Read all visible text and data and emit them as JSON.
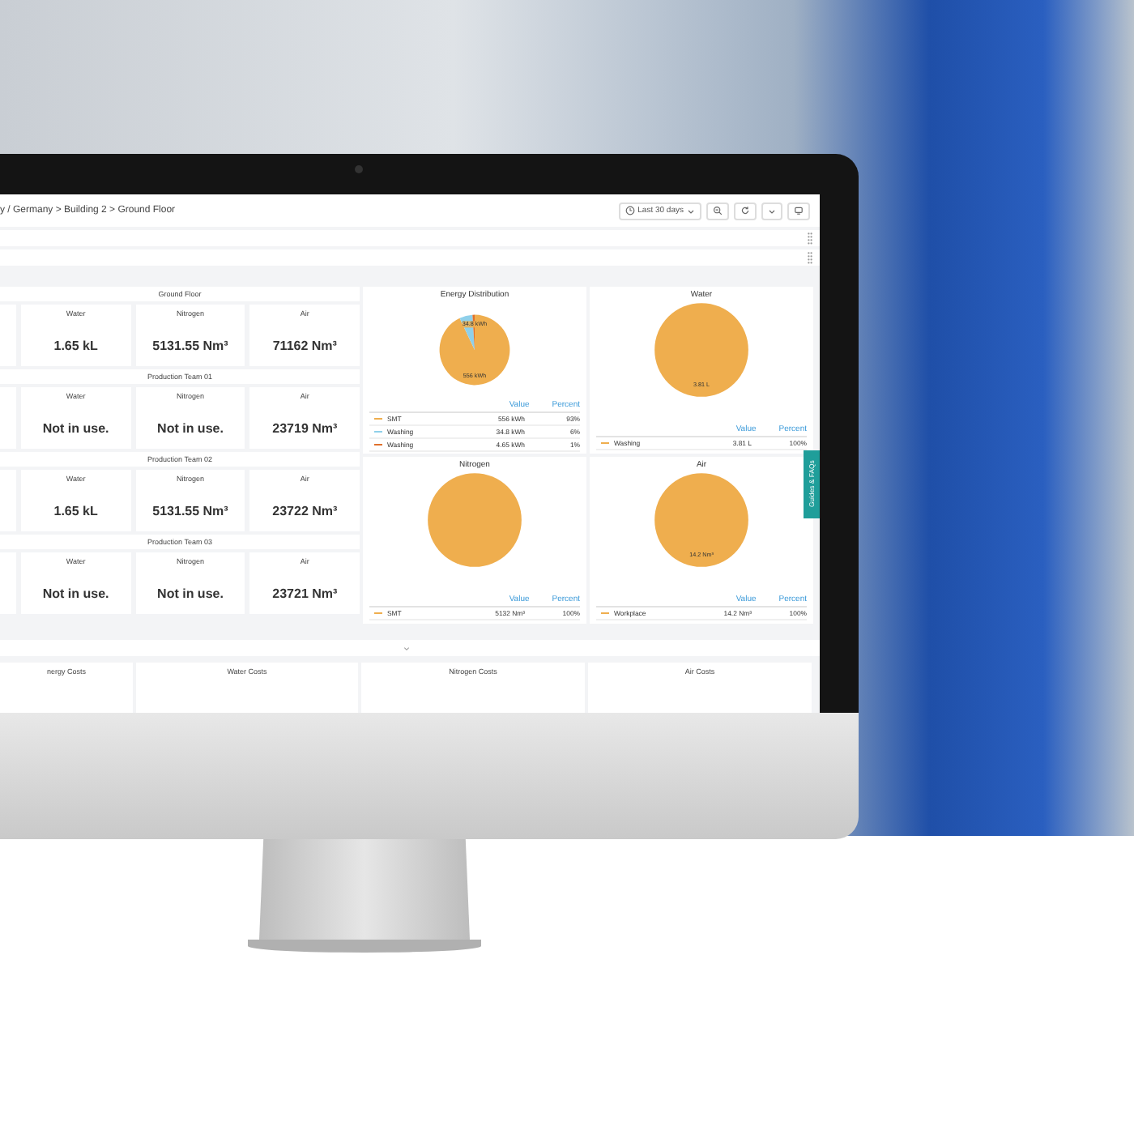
{
  "breadcrumb": "y / Germany > Building 2 > Ground Floor",
  "time_picker": "Last 30 days",
  "sections": [
    {
      "title": "Ground Floor",
      "tiles": [
        {
          "label": "Water",
          "value": "1.65 kL"
        },
        {
          "label": "Nitrogen",
          "value": "5131.55 Nm³"
        },
        {
          "label": "Air",
          "value": "71162 Nm³"
        }
      ]
    },
    {
      "title": "Production Team 01",
      "tiles": [
        {
          "label": "Water",
          "value": "Not in use."
        },
        {
          "label": "Nitrogen",
          "value": "Not in use."
        },
        {
          "label": "Air",
          "value": "23719 Nm³"
        }
      ]
    },
    {
      "title": "Production Team 02",
      "tiles": [
        {
          "label": "Water",
          "value": "1.65 kL"
        },
        {
          "label": "Nitrogen",
          "value": "5131.55 Nm³"
        },
        {
          "label": "Air",
          "value": "23722 Nm³"
        }
      ]
    },
    {
      "title": "Production Team 03",
      "tiles": [
        {
          "label": "Water",
          "value": "Not in use."
        },
        {
          "label": "Nitrogen",
          "value": "Not in use."
        },
        {
          "label": "Air",
          "value": "23721 Nm³"
        }
      ]
    }
  ],
  "pie_panels": [
    {
      "title": "Energy Distribution",
      "slice_labels": [
        "34.8 kWh",
        "556 kWh"
      ],
      "legend": {
        "value_header": "Value",
        "percent_header": "Percent",
        "rows": [
          {
            "name": "SMT",
            "value": "556 kWh",
            "percent": "93%",
            "color": "#efae4e"
          },
          {
            "name": "Washing",
            "value": "34.8 kWh",
            "percent": "6%",
            "color": "#8fd0ea"
          },
          {
            "name": "Washing",
            "value": "4.65 kWh",
            "percent": "1%",
            "color": "#e0702c"
          }
        ]
      }
    },
    {
      "title": "Water",
      "slice_labels": [
        "3.81 L"
      ],
      "legend": {
        "value_header": "Value",
        "percent_header": "Percent",
        "rows": [
          {
            "name": "Washing",
            "value": "3.81 L",
            "percent": "100%",
            "color": "#efae4e"
          }
        ]
      }
    },
    {
      "title": "Nitrogen",
      "legend": {
        "value_header": "Value",
        "percent_header": "Percent",
        "rows": [
          {
            "name": "SMT",
            "value": "5132 Nm³",
            "percent": "100%",
            "color": "#efae4e"
          }
        ]
      }
    },
    {
      "title": "Air",
      "slice_labels": [
        "14.2 Nm³"
      ],
      "legend": {
        "value_header": "Value",
        "percent_header": "Percent",
        "rows": [
          {
            "name": "Workplace",
            "value": "14.2 Nm³",
            "percent": "100%",
            "color": "#efae4e"
          }
        ]
      }
    }
  ],
  "guides_tab": "Guides & FAQs",
  "cost_panels": [
    {
      "title": "nergy Costs"
    },
    {
      "title": "Water Costs"
    },
    {
      "title": "Nitrogen Costs"
    },
    {
      "title": "Air Costs"
    }
  ]
}
